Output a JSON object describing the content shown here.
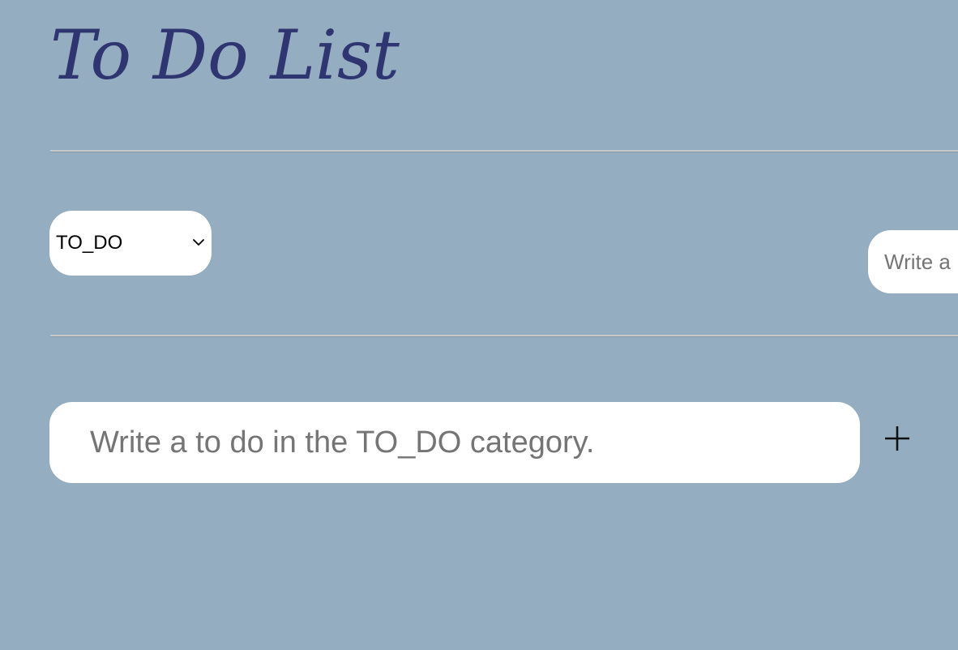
{
  "header": {
    "title": "To Do List"
  },
  "category": {
    "selected": "TO_DO",
    "options": [
      "TO_DO"
    ],
    "new_category_placeholder": "Write a"
  },
  "todo": {
    "input_placeholder": "Write a to do in the TO_DO category.",
    "add_button_icon": "plus-icon"
  },
  "colors": {
    "background": "#95adc0",
    "title": "#2f3570",
    "field": "#ffffff",
    "placeholder": "#757575"
  }
}
